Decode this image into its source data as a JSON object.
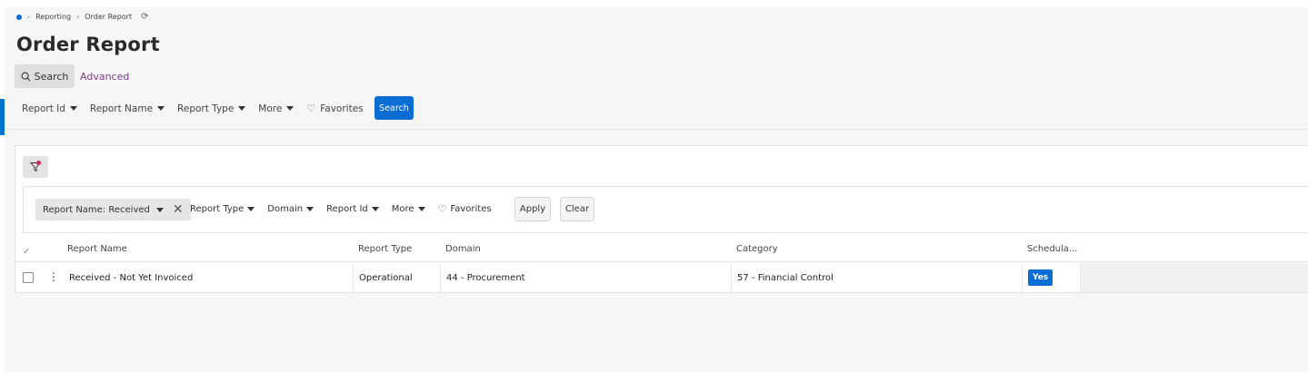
{
  "breadcrumb": {
    "items": [
      "Reporting",
      "Order Report"
    ]
  },
  "page": {
    "title": "Order Report"
  },
  "search_tabs": {
    "search_label": "Search",
    "advanced_label": "Advanced"
  },
  "top_filters": {
    "items": [
      "Report Id",
      "Report Name",
      "Report Type",
      "More"
    ],
    "favorites_label": "Favorites",
    "search_button": "Search"
  },
  "inner_filters": {
    "chip_label": "Report Name: Received",
    "items": [
      "Report Type",
      "Domain",
      "Report Id",
      "More"
    ],
    "favorites_label": "Favorites",
    "apply_label": "Apply",
    "clear_label": "Clear"
  },
  "table": {
    "columns": [
      "Report Name",
      "Report Type",
      "Domain",
      "Category",
      "Schedula..."
    ],
    "rows": [
      {
        "report_name": "Received - Not Yet Invoiced",
        "report_type": "Operational",
        "domain": "44 - Procurement",
        "category": "57 - Financial Control",
        "schedulable": "Yes"
      }
    ]
  },
  "colors": {
    "accent": "#0a6dd3",
    "link": "#7b3f86",
    "filter_dot": "#c0305a"
  },
  "icons": [
    "home-dot-icon",
    "chevron-right-icon",
    "refresh-icon",
    "search-icon",
    "caret-down-icon",
    "heart-icon",
    "funnel-icon",
    "close-icon",
    "kebab-icon",
    "checkmark-icon"
  ]
}
